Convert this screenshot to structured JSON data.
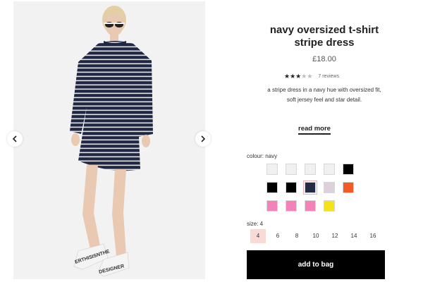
{
  "product": {
    "title_line1": "navy oversized t-shirt",
    "title_line2": "stripe dress",
    "price": "£18.00",
    "rating": 3,
    "rating_max": 5,
    "reviews_label": "7 reviews",
    "description_line1": "a stripe dress in a navy hue with oversized fit,",
    "description_line2": "soft jersey feel and star detail.",
    "read_more_label": "read more"
  },
  "gallery": {
    "shoe_text_left": "ERTHISISNTHE",
    "shoe_text_right": "DESIGNER"
  },
  "colour": {
    "label": "colour: navy",
    "swatches": [
      {
        "name": "white-1",
        "color": "#f0f0f0"
      },
      {
        "name": "white-2",
        "color": "#f0f0f0"
      },
      {
        "name": "white-3",
        "color": "#f0f0f0"
      },
      {
        "name": "white-4",
        "color": "#f0f0f0"
      },
      {
        "name": "black-1",
        "color": "#000000"
      },
      {
        "name": "black-2",
        "color": "#000000"
      },
      {
        "name": "black-3",
        "color": "#000000"
      },
      {
        "name": "navy",
        "color": "#252a45",
        "selected": true
      },
      {
        "name": "lilac",
        "color": "#dcd0dc"
      },
      {
        "name": "orange",
        "color": "#f25c24"
      },
      {
        "name": "pink-1",
        "color": "#f382b8"
      },
      {
        "name": "pink-2",
        "color": "#f382b8"
      },
      {
        "name": "pink-3",
        "color": "#f382b8"
      },
      {
        "name": "yellow",
        "color": "#f6e21b"
      }
    ]
  },
  "size": {
    "label": "size: 4",
    "options": [
      "4",
      "6",
      "8",
      "10",
      "12",
      "14",
      "16"
    ],
    "selected": "4"
  },
  "add_to_bag_label": "add to bag",
  "colors": {
    "accent_pink": "#f8dbd7",
    "button": "#000000"
  }
}
